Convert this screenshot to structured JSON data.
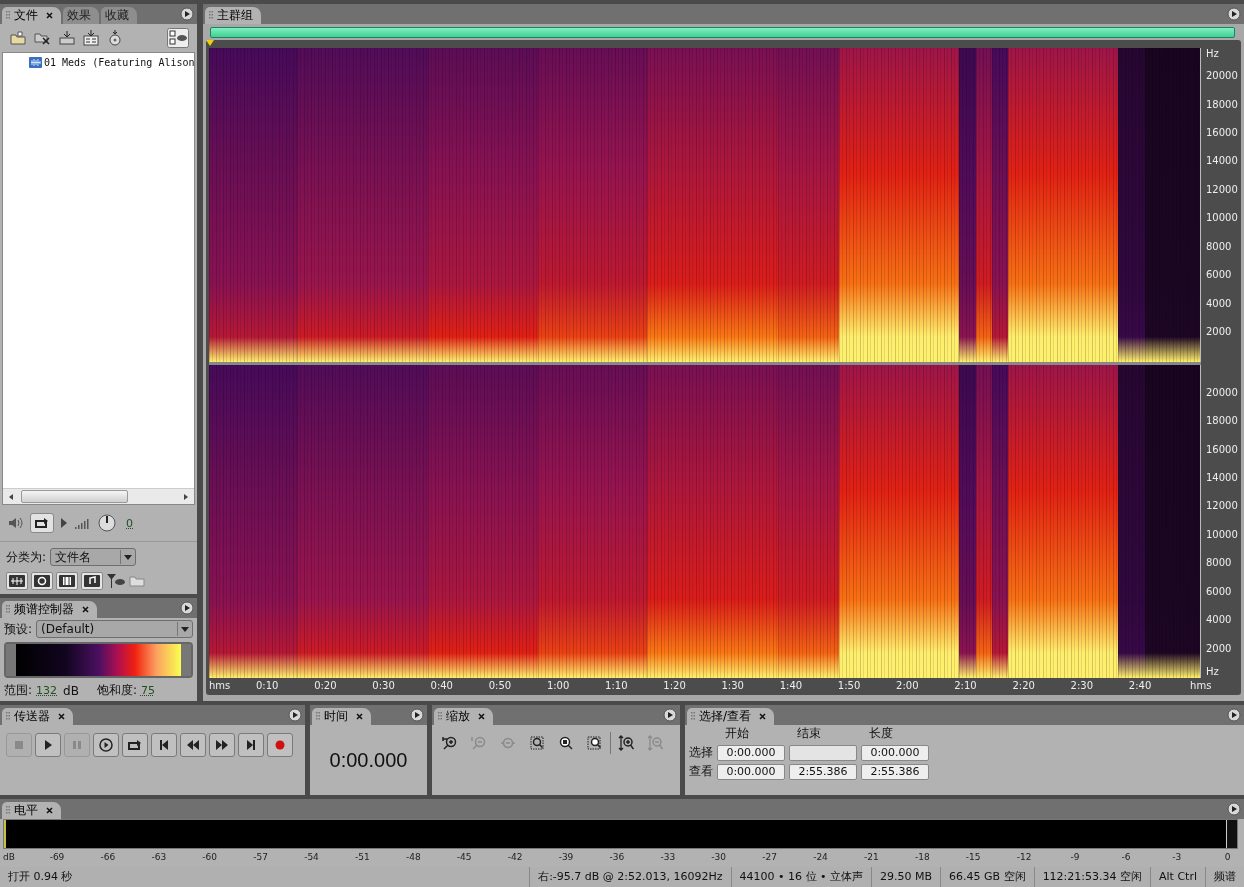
{
  "file_panel": {
    "tabs": [
      {
        "label": "文件",
        "selected": true,
        "closable": true
      },
      {
        "label": "效果",
        "selected": false,
        "closable": false
      },
      {
        "label": "收藏",
        "selected": false,
        "closable": false
      }
    ],
    "files": [
      {
        "name": "01 Meds (Featuring Alison",
        "selected": false
      }
    ],
    "volume_value": "0",
    "sort_label": "分类为:",
    "sort_value": "文件名"
  },
  "spectral_controller": {
    "title": "频谱控制器",
    "preset_label": "预设:",
    "preset_value": "(Default)",
    "range_label": "范围:",
    "range_value": "132",
    "range_unit": "dB",
    "saturation_label": "饱和度:",
    "saturation_value": "75"
  },
  "editor": {
    "tab": "主群组",
    "channels": [
      {
        "freq_unit": "Hz",
        "freq_ticks": [
          "20000",
          "18000",
          "16000",
          "14000",
          "12000",
          "10000",
          "8000",
          "6000",
          "4000",
          "2000"
        ]
      },
      {
        "freq_unit": "Hz",
        "freq_ticks": [
          "20000",
          "18000",
          "16000",
          "14000",
          "12000",
          "10000",
          "8000",
          "6000",
          "4000",
          "2000"
        ]
      }
    ],
    "time_unit_start": "hms",
    "time_unit_end": "hms",
    "time_ticks": [
      "0:10",
      "0:20",
      "0:30",
      "0:40",
      "0:50",
      "1:00",
      "1:10",
      "1:20",
      "1:30",
      "1:40",
      "1:50",
      "2:00",
      "2:10",
      "2:20",
      "2:30",
      "2:40"
    ]
  },
  "transport": {
    "title": "传送器",
    "buttons": [
      {
        "kind": "stop",
        "disabled": true
      },
      {
        "kind": "play",
        "disabled": false
      },
      {
        "kind": "pause",
        "disabled": true
      },
      {
        "kind": "play-from",
        "disabled": false
      },
      {
        "kind": "loop",
        "disabled": false
      },
      {
        "kind": "go-start",
        "disabled": false
      },
      {
        "kind": "rewind",
        "disabled": false
      },
      {
        "kind": "forward",
        "disabled": false
      },
      {
        "kind": "go-end",
        "disabled": false
      },
      {
        "kind": "record",
        "disabled": false
      }
    ]
  },
  "time": {
    "title": "时间",
    "value": "0:00.000"
  },
  "zoom": {
    "title": "缩放",
    "buttons": [
      {
        "kind": "zoom-in-h",
        "disabled": false
      },
      {
        "kind": "zoom-out-h",
        "disabled": true
      },
      {
        "kind": "zoom-out-full",
        "disabled": true
      },
      {
        "kind": "zoom-left",
        "disabled": false
      },
      {
        "kind": "zoom-selection",
        "disabled": false
      },
      {
        "kind": "zoom-right",
        "disabled": false
      },
      {
        "kind": "zoom-in-v",
        "disabled": false
      },
      {
        "kind": "zoom-out-v",
        "disabled": true
      }
    ]
  },
  "selection": {
    "title": "选择/查看",
    "columns": [
      "开始",
      "结束",
      "长度"
    ],
    "rows": [
      {
        "label": "选择",
        "values": [
          {
            "value": "0:00.000"
          },
          {
            "empty": true
          },
          {
            "value": "0:00.000"
          }
        ]
      },
      {
        "label": "查看",
        "values": [
          {
            "value": "0:00.000"
          },
          {
            "value": "2:55.386"
          },
          {
            "value": "2:55.386"
          }
        ]
      }
    ]
  },
  "levels": {
    "title": "电平",
    "unit": "dB",
    "ticks": [
      "-69",
      "-66",
      "-63",
      "-60",
      "-57",
      "-54",
      "-51",
      "-48",
      "-45",
      "-42",
      "-39",
      "-36",
      "-33",
      "-30",
      "-27",
      "-24",
      "-21",
      "-18",
      "-15",
      "-12",
      "-9",
      "-6",
      "-3",
      "0"
    ]
  },
  "status_bar": [
    "打开 0.94 秒",
    "右:-95.7 dB @  2:52.013, 16092Hz",
    "44100 • 16 位 • 立体声",
    "29.50 MB",
    "66.45 GB 空闲",
    "112:21:53.34 空闲",
    "Alt Ctrl",
    "频谱"
  ]
}
